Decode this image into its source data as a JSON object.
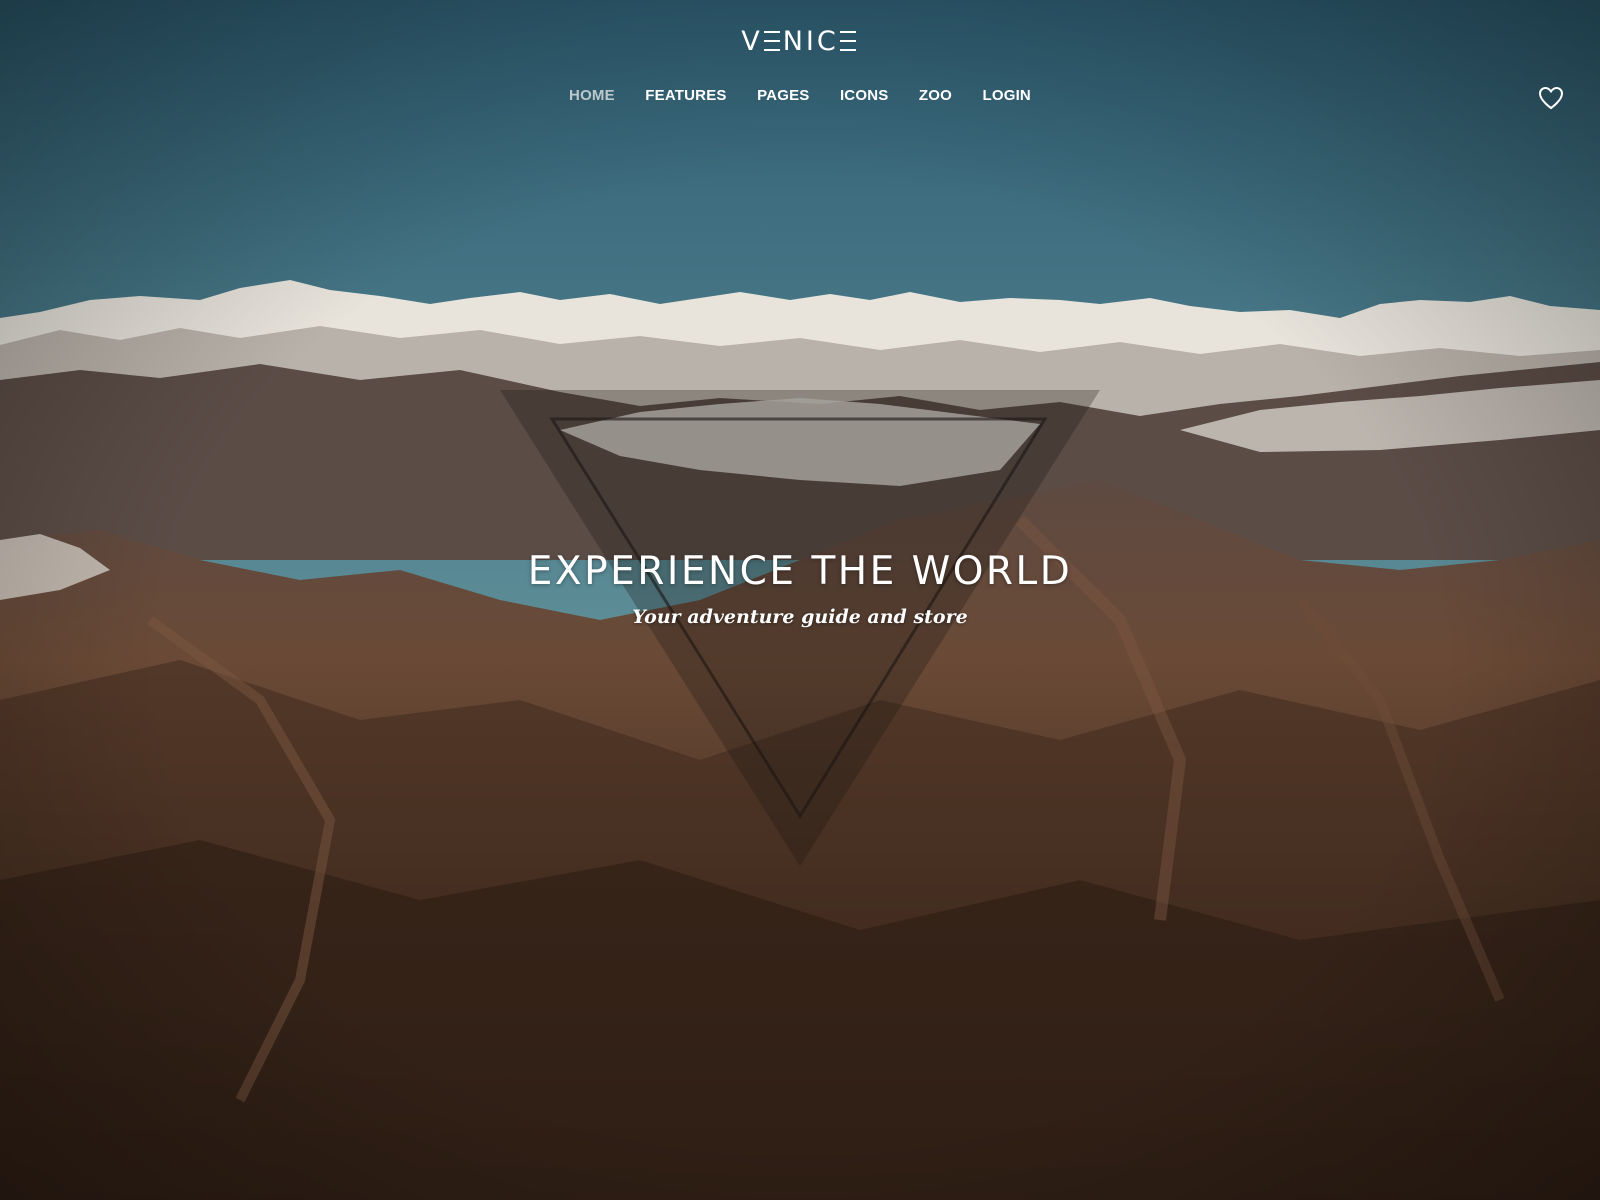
{
  "header": {
    "logo": {
      "first": "V",
      "rest": "NIC"
    },
    "nav": [
      {
        "label": "HOME",
        "active": true
      },
      {
        "label": "FEATURES",
        "active": false
      },
      {
        "label": "PAGES",
        "active": false
      },
      {
        "label": "ICONS",
        "active": false
      },
      {
        "label": "ZOO",
        "active": false
      },
      {
        "label": "LOGIN",
        "active": false
      }
    ],
    "wishlist_icon": "heart-outline-icon"
  },
  "hero": {
    "title": "EXPERIENCE THE WORLD",
    "subtitle": "Your adventure guide and store",
    "background": "aerial photo of snow-capped mountain ranges",
    "overlay_shape": "inverted-triangle"
  },
  "colors": {
    "sky_top": "#3f6f80",
    "sky_horizon": "#7aa3a3",
    "mountain": "#6b4a38",
    "text": "#ffffff",
    "nav_active": "#bcc8cb"
  }
}
